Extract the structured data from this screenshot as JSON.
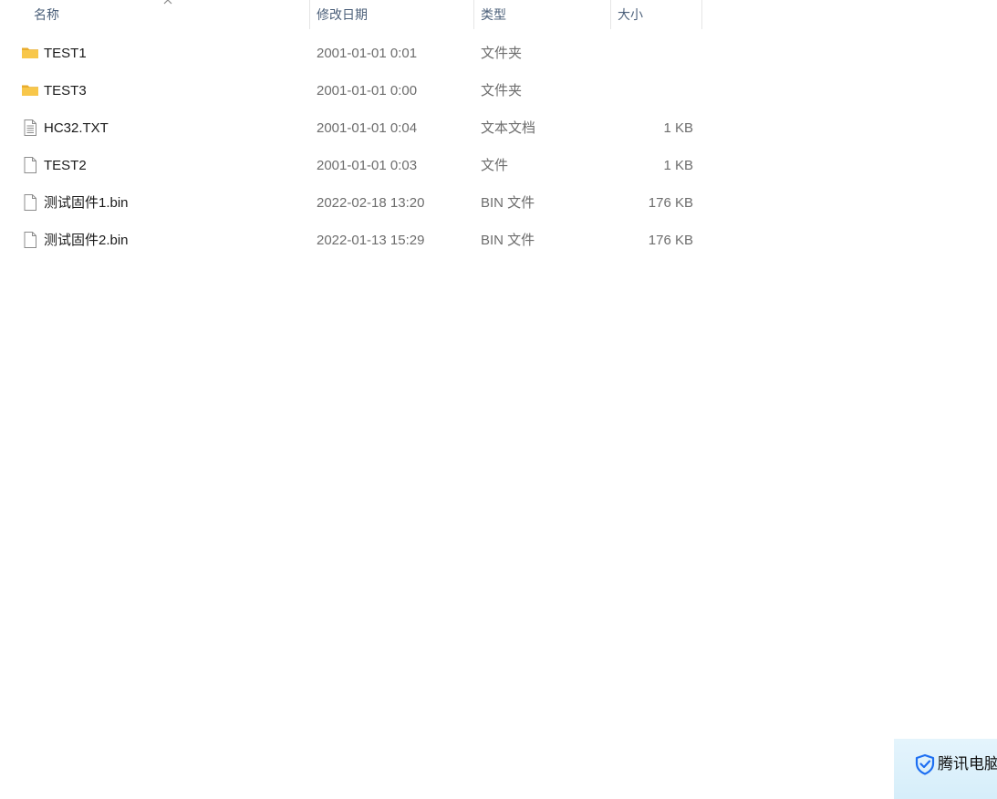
{
  "columns": {
    "name": "名称",
    "date": "修改日期",
    "type": "类型",
    "size": "大小"
  },
  "files": [
    {
      "name": "TEST1",
      "date": "2001-01-01 0:01",
      "type": "文件夹",
      "size": "",
      "icon": "folder-icon"
    },
    {
      "name": "TEST3",
      "date": "2001-01-01 0:00",
      "type": "文件夹",
      "size": "",
      "icon": "folder-icon"
    },
    {
      "name": "HC32.TXT",
      "date": "2001-01-01 0:04",
      "type": "文本文档",
      "size": "1 KB",
      "icon": "text-file-icon"
    },
    {
      "name": "TEST2",
      "date": "2001-01-01 0:03",
      "type": "文件",
      "size": "1 KB",
      "icon": "file-icon"
    },
    {
      "name": "测试固件1.bin",
      "date": "2022-02-18 13:20",
      "type": "BIN 文件",
      "size": "176 KB",
      "icon": "file-icon"
    },
    {
      "name": "测试固件2.bin",
      "date": "2022-01-13 15:29",
      "type": "BIN 文件",
      "size": "176 KB",
      "icon": "file-icon"
    }
  ],
  "tencent": {
    "label": "腾讯电脑"
  },
  "colors": {
    "header_text": "#4c607a",
    "folder": "#f8c74a",
    "tencent_bg": "#dff1fb",
    "tencent_icon": "#1d6ff2"
  }
}
